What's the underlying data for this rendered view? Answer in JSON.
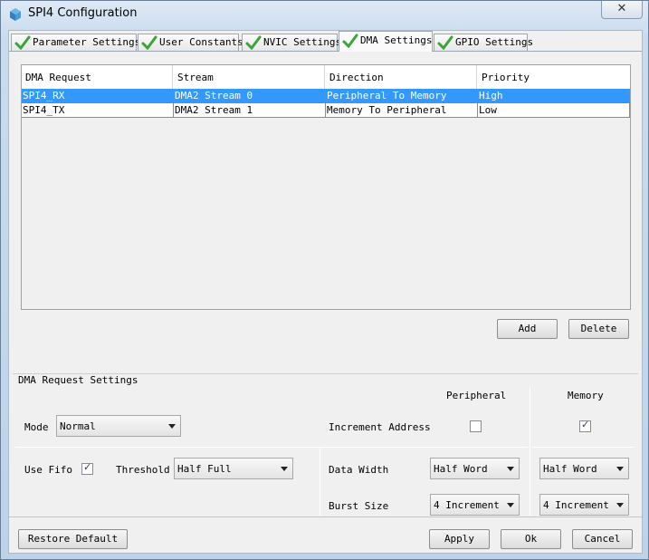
{
  "window": {
    "title": "SPI4 Configuration",
    "close_glyph": "✕"
  },
  "tabs": [
    {
      "label": "Parameter Settings"
    },
    {
      "label": "User Constants"
    },
    {
      "label": "NVIC Settings"
    },
    {
      "label": "DMA Settings"
    },
    {
      "label": "GPIO Settings"
    }
  ],
  "dma_table": {
    "columns": [
      "DMA Request",
      "Stream",
      "Direction",
      "Priority"
    ],
    "rows": [
      {
        "request": "SPI4_RX",
        "stream": "DMA2 Stream 0",
        "direction": "Peripheral To Memory",
        "priority": "High"
      },
      {
        "request": "SPI4_TX",
        "stream": "DMA2 Stream 1",
        "direction": "Memory To Peripheral",
        "priority": "Low"
      }
    ]
  },
  "buttons": {
    "add": "Add",
    "delete": "Delete",
    "restore_default": "Restore Default",
    "apply": "Apply",
    "ok": "Ok",
    "cancel": "Cancel"
  },
  "request_settings": {
    "title": "DMA Request Settings",
    "peripheral_header": "Peripheral",
    "memory_header": "Memory",
    "mode_label": "Mode",
    "mode_value": "Normal",
    "increment_address_label": "Increment Address",
    "increment_peripheral": false,
    "increment_memory": true,
    "use_fifo_label": "Use Fifo",
    "use_fifo": true,
    "threshold_label": "Threshold",
    "threshold_value": "Half Full",
    "data_width_label": "Data Width",
    "data_width_peripheral": "Half Word",
    "data_width_memory": "Half Word",
    "burst_size_label": "Burst Size",
    "burst_size_peripheral": "4 Increment",
    "burst_size_memory": "4 Increment",
    "check_glyph": "✓"
  },
  "colors": {
    "selection": "#3399ff",
    "tab_check": "#3aa63a"
  }
}
